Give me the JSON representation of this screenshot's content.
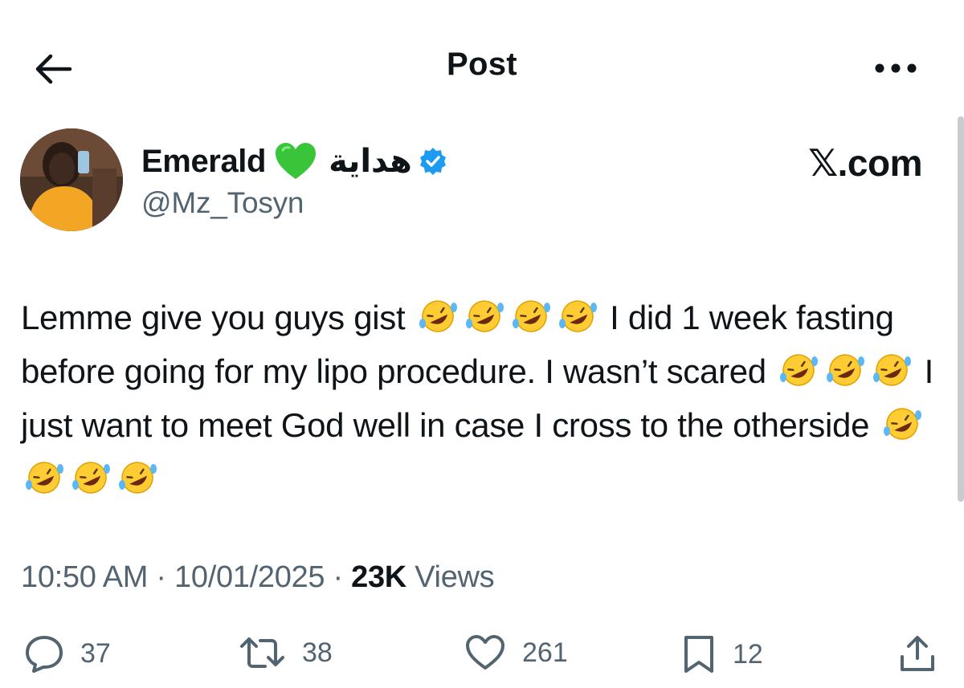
{
  "header": {
    "title": "Post",
    "back_icon": "arrow-left-icon",
    "more_icon": "more-horizontal-icon"
  },
  "author": {
    "display_name": "Emerald",
    "heart_emoji": "green-heart-icon",
    "arabic_name": "هداية",
    "verified_icon": "verified-badge-icon",
    "handle": "@Mz_Tosyn"
  },
  "watermark": "𝕏.com",
  "tweet": {
    "segment_1": "Lemme give you guys gist",
    "segment_2": "I did 1 week fasting before going for my lipo procedure. I wasn’t scared",
    "segment_3": "I just want to meet God well in case I cross to the otherside",
    "emoji": "rolling-on-floor-laughing-icon"
  },
  "meta": {
    "time": "10:50 AM",
    "sep1": "·",
    "date": "10/01/2025",
    "sep2": "·",
    "views_count": "23K",
    "views_label": "Views"
  },
  "actions": {
    "replies": "37",
    "reposts": "38",
    "likes": "261",
    "bookmarks": "12"
  },
  "colors": {
    "text": "#0f1419",
    "secondary": "#536471",
    "verified": "#1d9bf0",
    "heart": "#2ecc40"
  }
}
